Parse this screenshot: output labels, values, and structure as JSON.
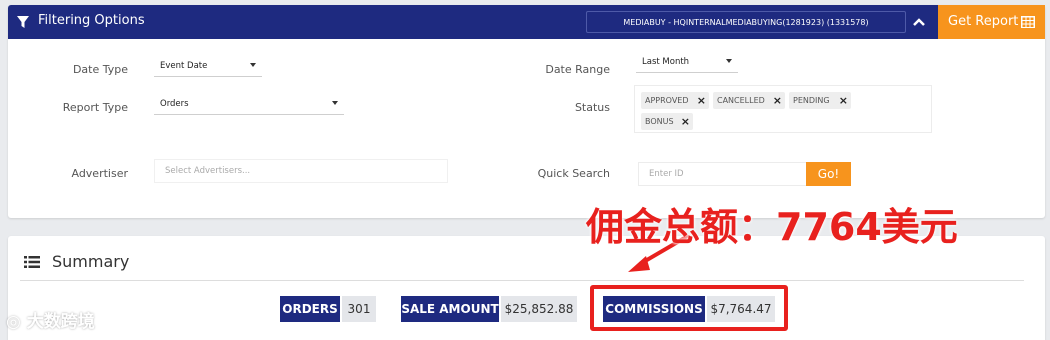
{
  "header": {
    "title": "Filtering Options",
    "account": "MEDIABUY - HQINTERNALMEDIABUYING(1281923) (1331578)",
    "get_report_label": "Get Report"
  },
  "filters": {
    "date_type": {
      "label": "Date Type",
      "value": "Event Date"
    },
    "report_type": {
      "label": "Report Type",
      "value": "Orders"
    },
    "advertiser": {
      "label": "Advertiser",
      "placeholder": "Select Advertisers..."
    },
    "date_range": {
      "label": "Date Range",
      "value": "Last Month"
    },
    "status": {
      "label": "Status",
      "tags": [
        "APPROVED",
        "CANCELLED",
        "PENDING",
        "BONUS"
      ]
    },
    "quick_search": {
      "label": "Quick Search",
      "placeholder": "Enter ID",
      "button_label": "Go!"
    }
  },
  "annotation": {
    "text": "佣金总额：7764美元",
    "color": "#e8211e"
  },
  "summary": {
    "title": "Summary",
    "metrics": [
      {
        "label": "ORDERS",
        "value": "301"
      },
      {
        "label": "SALE AMOUNT",
        "value": "$25,852.88"
      },
      {
        "label": "COMMISSIONS",
        "value": "$7,764.47"
      }
    ]
  },
  "watermark": {
    "text": "大数跨境"
  },
  "colors": {
    "header_bg": "#1e2a80",
    "accent_orange": "#f7941d",
    "highlight_red": "#e8211e"
  }
}
